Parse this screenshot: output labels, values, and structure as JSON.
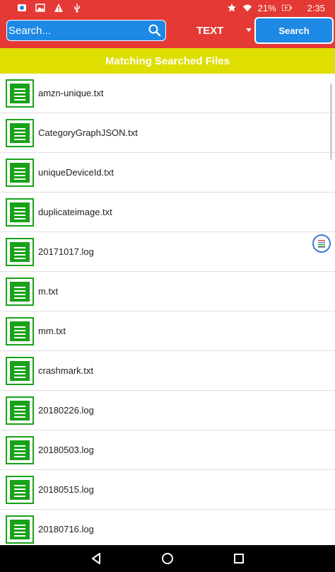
{
  "status_bar": {
    "battery": "21%",
    "time": "2:35",
    "left_icons": [
      "gallery-app-icon",
      "image-icon",
      "warning-icon",
      "usb-icon"
    ],
    "right_icons": [
      "star-icon",
      "wifi-icon",
      "battery-charging-icon"
    ]
  },
  "toolbar": {
    "search_placeholder": "Search...",
    "type_selected": "TEXT",
    "search_button": "Search"
  },
  "banner": {
    "title": "Matching Searched Files"
  },
  "files": [
    {
      "name": "amzn-unique.txt"
    },
    {
      "name": "CategoryGraphJSON.txt"
    },
    {
      "name": "uniqueDeviceId.txt"
    },
    {
      "name": "duplicateimage.txt"
    },
    {
      "name": "20171017.log"
    },
    {
      "name": "m.txt"
    },
    {
      "name": "mm.txt"
    },
    {
      "name": "crashmark.txt"
    },
    {
      "name": "20180226.log"
    },
    {
      "name": "20180503.log"
    },
    {
      "name": "20180515.log"
    },
    {
      "name": "20180716.log"
    }
  ],
  "colors": {
    "app_bar": "#e53935",
    "accent_blue": "#1e88e5",
    "banner_yellow": "#dede00",
    "file_icon_green": "#18a218"
  }
}
